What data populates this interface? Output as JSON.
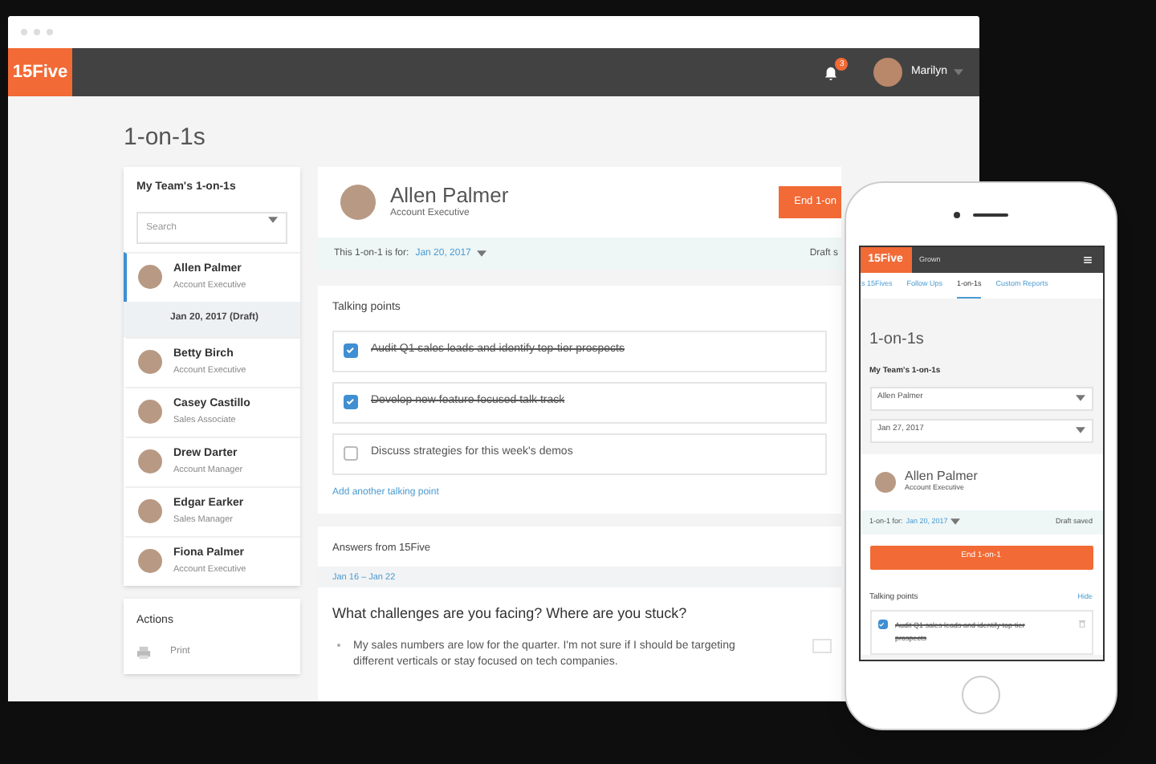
{
  "browser": {
    "logo": "15Five",
    "notifications": "3",
    "user": "Marilyn"
  },
  "page_title": "1-on-1s",
  "sidebar": {
    "heading": "My Team's 1-on-1s",
    "search": {
      "placeholder": "Search"
    },
    "people": [
      {
        "name": "Allen Palmer",
        "role": "Account Executive",
        "selected": true,
        "draft": "Jan 20, 2017 (Draft)"
      },
      {
        "name": "Betty Birch",
        "role": "Account Executive",
        "selected": false
      },
      {
        "name": "Casey Castillo",
        "role": "Sales Associate",
        "selected": false
      },
      {
        "name": "Drew Darter",
        "role": "Account Manager",
        "selected": false
      },
      {
        "name": "Edgar Earker",
        "role": "Sales Manager",
        "selected": false
      },
      {
        "name": "Fiona Palmer",
        "role": "Account Executive",
        "selected": false
      }
    ],
    "actions": {
      "heading": "Actions",
      "items": [
        "Print"
      ]
    }
  },
  "main": {
    "name": "Allen Palmer",
    "role": "Account Executive",
    "end_button": "End 1-on",
    "date_label": "This 1-on-1 is for:",
    "date": "Jan 20, 2017",
    "status": "Draft s",
    "talking_points": {
      "heading": "Talking points",
      "items": [
        {
          "text": "Audit Q1 sales leads and identify top-tier prospects",
          "checked": true
        },
        {
          "text": "Develop new feature focused talk track",
          "checked": true
        },
        {
          "text": "Discuss strategies for this week's demos",
          "checked": false
        }
      ],
      "add_link": "Add another talking point"
    },
    "answers": {
      "heading": "Answers from 15Five",
      "range": "Jan 16 – Jan 22",
      "question": "What challenges are you facing? Where are you stuck?",
      "answers": [
        "My sales numbers are low for the quarter. I'm not sure if I should be targeting different verticals or stay focused on tech companies."
      ]
    }
  },
  "phone": {
    "logo": "15Five",
    "group": "Grown",
    "tabs": [
      {
        "label": "s 15Fives",
        "selected": false
      },
      {
        "label": "Follow Ups",
        "selected": false
      },
      {
        "label": "1-on-1s",
        "selected": true
      },
      {
        "label": "Custom Reports",
        "selected": false
      }
    ],
    "title": "1-on-1s",
    "heading": "My Team's 1-on-1s",
    "person_select": "Allen Palmer",
    "date_select": "Jan 27, 2017",
    "name": "Allen Palmer",
    "role": "Account Executive",
    "date_label": "1-on-1 for:",
    "date": "Jan 20, 2017",
    "status": "Draft saved",
    "end_button": "End 1-on-1",
    "talking_heading": "Talking points",
    "hide_link": "Hide",
    "items": [
      {
        "text": "Audit Q1 sales leads and identify top-tier prospects",
        "checked": true
      }
    ]
  }
}
